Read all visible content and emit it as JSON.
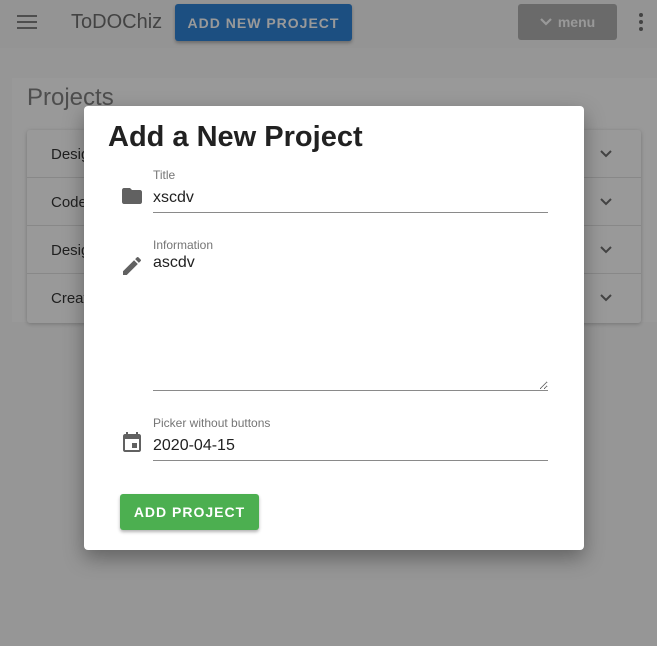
{
  "appbar": {
    "title": "ToDOChiz",
    "new_project_label": "ADD NEW PROJECT",
    "menu_label": "menu"
  },
  "projects": {
    "heading": "Projects",
    "items": [
      {
        "label": "Desig"
      },
      {
        "label": "Code"
      },
      {
        "label": "Desig"
      },
      {
        "label": "Creat"
      }
    ]
  },
  "dialog": {
    "title": "Add a New Project",
    "title_field": {
      "label": "Title",
      "value": "xscdv",
      "icon": "folder-icon"
    },
    "info_field": {
      "label": "Information",
      "value": "ascdv",
      "icon": "pencil-icon"
    },
    "date_field": {
      "label": "Picker without buttons",
      "value": "2020-04-15",
      "icon": "calendar-icon"
    },
    "submit_label": "ADD PROJECT"
  },
  "colors": {
    "primary": "#1976d2",
    "success": "#4caf50",
    "overlay": "#212121"
  }
}
